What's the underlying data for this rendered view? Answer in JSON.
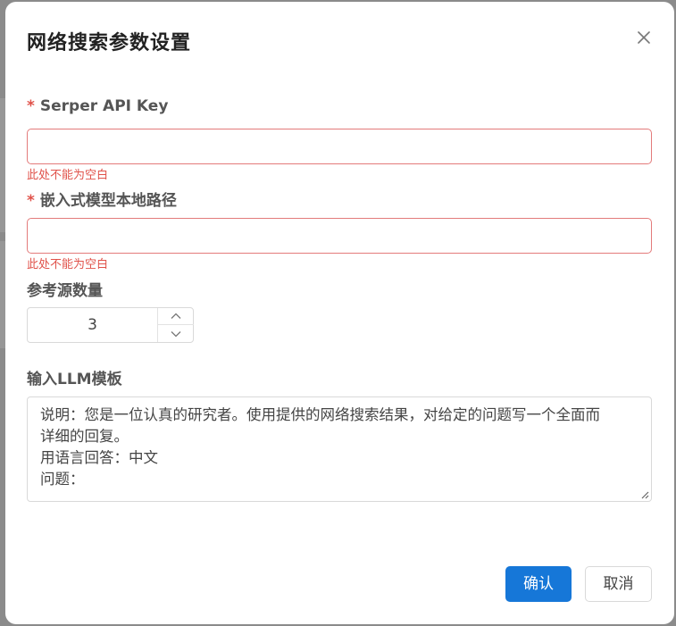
{
  "dialog": {
    "title": "网络搜索参数设置",
    "close_icon": "close-icon"
  },
  "form": {
    "serper": {
      "required_mark": "*",
      "label": "Serper API Key",
      "value": "",
      "error": "此处不能为空白"
    },
    "embed_path": {
      "required_mark": "*",
      "label": "嵌入式模型本地路径",
      "value": "",
      "error": "此处不能为空白"
    },
    "source_count": {
      "label": "参考源数量",
      "value": "3",
      "up_icon": "chevron-up-icon",
      "down_icon": "chevron-down-icon"
    },
    "llm_template": {
      "label": "输入LLM模板",
      "lines": [
        "说明：您是一位认真的研究者。使用提供的网络搜索结果，对给定的问题写一个全面而",
        "详细的回复。",
        "用语言回答：中文",
        "问题："
      ]
    }
  },
  "footer": {
    "confirm_label": "确认",
    "cancel_label": "取消"
  },
  "colors": {
    "primary": "#1677d8",
    "error": "#e0524a",
    "error_border": "#e37b7b"
  }
}
